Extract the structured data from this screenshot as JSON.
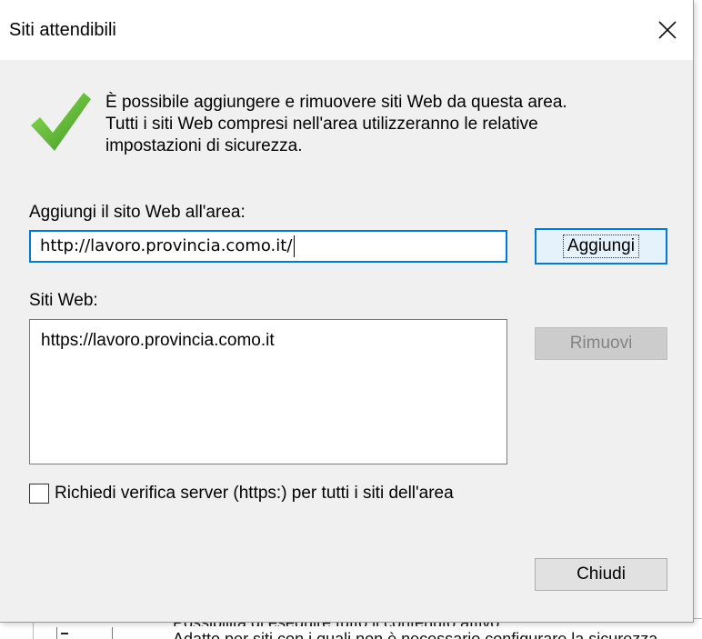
{
  "dialog": {
    "title": "Siti attendibili",
    "close_icon": "close-icon"
  },
  "info": {
    "icon": "checkmark-icon",
    "line1": "È possibile aggiungere e rimuovere siti Web da questa area.",
    "line2": "Tutti i siti Web compresi nell'area utilizzeranno le relative",
    "line3": "impostazioni di sicurezza."
  },
  "add_site": {
    "label": "Aggiungi il sito Web all'area:",
    "value": "http://lavoro.provincia.como.it/",
    "button_label": "Aggiungi"
  },
  "sites": {
    "label": "Siti Web:",
    "items": [
      "https://lavoro.provincia.como.it"
    ],
    "remove_label": "Rimuovi"
  },
  "https_check": {
    "label": "Richiedi verifica server (https:) per tutti i siti dell'area",
    "checked": false
  },
  "footer": {
    "close_label": "Chiudi"
  },
  "background": {
    "line1": "Possibilità di eseguire tutto il contenuto attivo",
    "line2": "Adatto per siti con i quali non è necessario configurare la sicurezza"
  },
  "colors": {
    "accent": "#0078d7",
    "check_green": "#5cb531",
    "dialog_bg": "#f0f0f0"
  }
}
